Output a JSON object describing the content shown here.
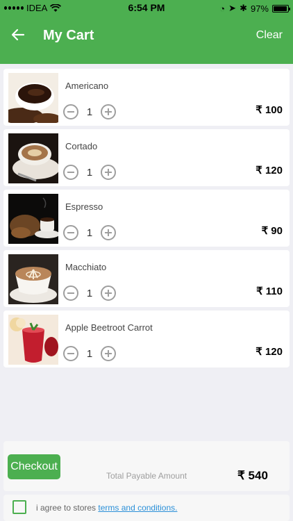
{
  "status_bar": {
    "carrier": "IDEA",
    "time": "6:54 PM",
    "battery": "97%",
    "battery_level": 0.97
  },
  "header": {
    "title": "My Cart",
    "clear_label": "Clear",
    "back_icon": "arrow-left-icon"
  },
  "cart": {
    "items": [
      {
        "name": "Americano",
        "qty": "1",
        "price": "₹ 100"
      },
      {
        "name": "Cortado",
        "qty": "1",
        "price": "₹ 120"
      },
      {
        "name": "Espresso",
        "qty": "1",
        "price": "₹ 90"
      },
      {
        "name": "Macchiato",
        "qty": "1",
        "price": "₹ 110"
      },
      {
        "name": "Apple Beetroot Carrot",
        "qty": "1",
        "price": "₹ 120"
      }
    ]
  },
  "summary": {
    "checkout_label": "Checkout",
    "total_label": "Total Payable Amount",
    "total_value": "₹ 540"
  },
  "terms": {
    "text": "i agree to stores",
    "link": "terms and conditions."
  },
  "colors": {
    "primary": "#4caf50",
    "link": "#2a8fd8"
  }
}
